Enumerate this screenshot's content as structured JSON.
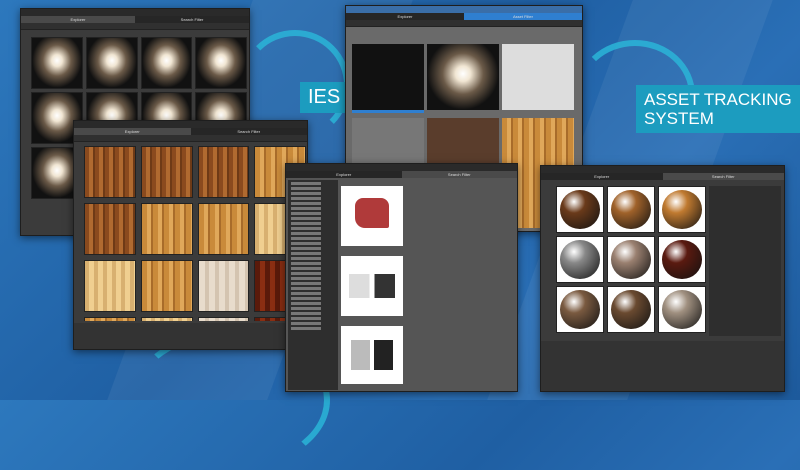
{
  "labels": {
    "ies": "IES",
    "asset_line1": "ASSET TRACKING",
    "asset_line2": "SYSTEM"
  },
  "windows": {
    "ies": {
      "tab_explorer": "Explorer",
      "tab_search": "Search Filter"
    },
    "asset": {
      "tab_explorer": "Explorer",
      "tab_search": "Asset Filter"
    },
    "wood": {
      "tab_explorer": "Explorer",
      "tab_search": "Search Filter"
    },
    "chairs": {
      "tab_explorer": "Explorer",
      "tab_search": "Search Filter"
    },
    "spheres": {
      "tab_explorer": "Explorer",
      "tab_search": "Search Filter"
    }
  },
  "colors": {
    "accent": "#1c9cbf",
    "selection": "#2f7fd0",
    "window": "#3b3b3b"
  }
}
